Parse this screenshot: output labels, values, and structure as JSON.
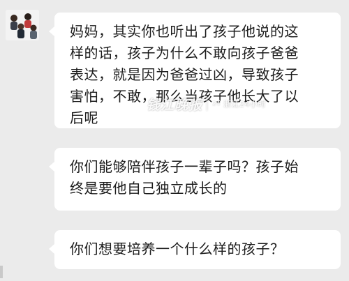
{
  "chat": {
    "messages": [
      {
        "text": "妈妈，其实你也听出了孩子他说的这\n样的话，孩子为什么不敢向孩子爸爸\n表达，就是因为爸爸过凶，导致孩子\n害怕，不敢，那么当孩子他长大了以\n后呢"
      },
      {
        "text": "你们能够陪伴孩子一辈子吗？孩子始\n终是要他自己独立成长的"
      },
      {
        "text": "你们想要培养一个什么样的孩子？"
      }
    ]
  },
  "watermark": {
    "brand": "钱江晚报",
    "sub": "浙江24小时",
    "icon": "circle-24-icon"
  },
  "colors": {
    "background": "#ebebeb",
    "bubble": "#ffffff",
    "text": "#1c1c1c"
  }
}
